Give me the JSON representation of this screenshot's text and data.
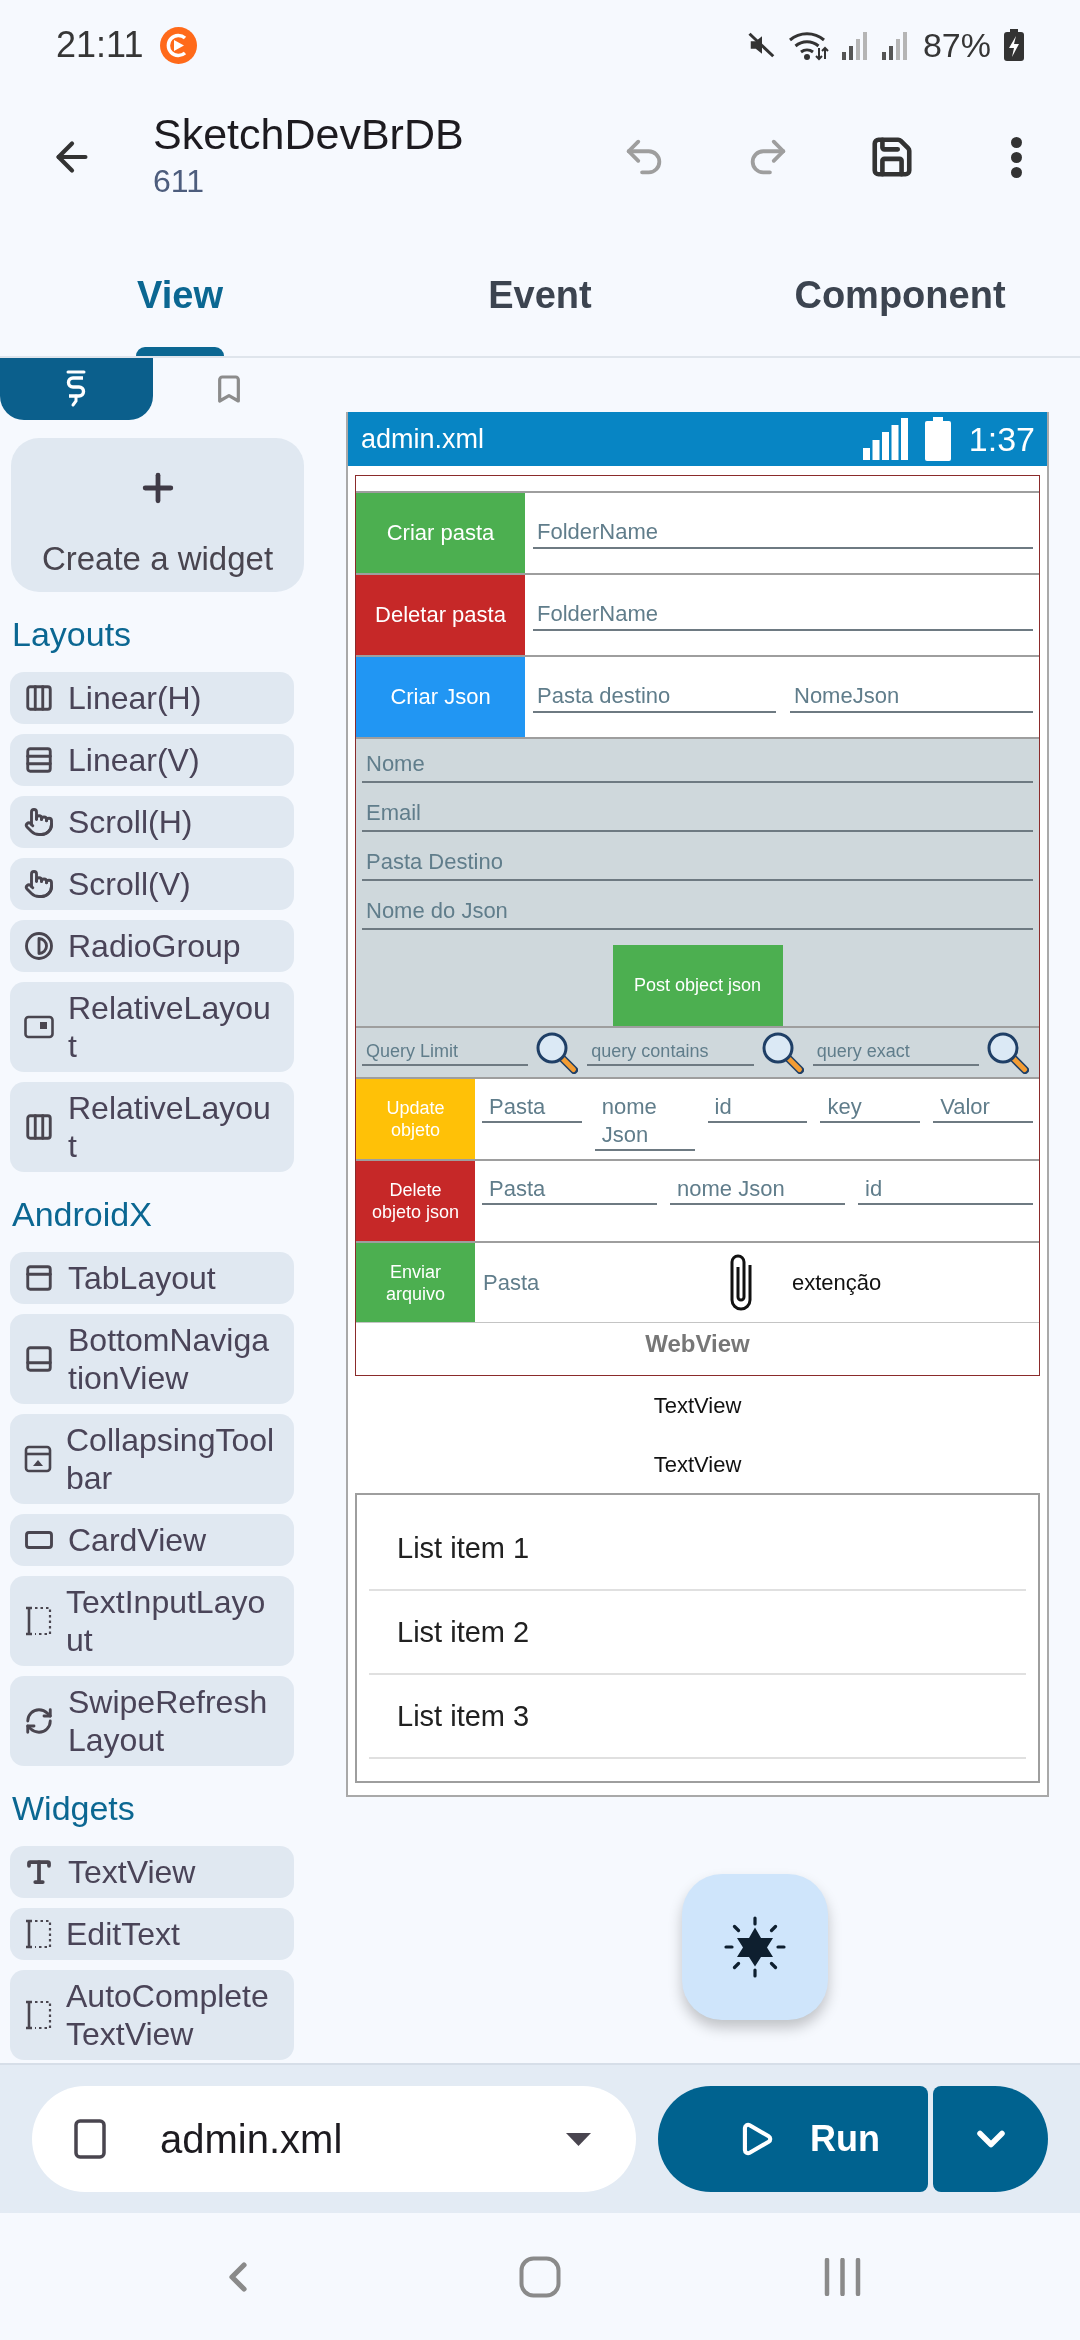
{
  "status_bar": {
    "time": "21:11",
    "battery": "87%"
  },
  "app_bar": {
    "title": "SketchDevBrDB",
    "subtitle": "611",
    "actions": [
      {
        "kind": "undo",
        "disabled": true
      },
      {
        "kind": "redo",
        "disabled": true
      },
      {
        "kind": "save",
        "disabled": false
      },
      {
        "kind": "more",
        "disabled": false
      }
    ]
  },
  "tabs": [
    {
      "label": "View",
      "selected": true
    },
    {
      "label": "Event",
      "selected": false
    },
    {
      "label": "Component",
      "selected": false
    }
  ],
  "palette": {
    "tabs": [
      {
        "kind": "widgets",
        "selected": true
      },
      {
        "kind": "bookmarks",
        "selected": false
      }
    ],
    "create_button": "Create a widget",
    "sections": [
      {
        "title": "Layouts",
        "items": [
          {
            "label": "Linear(H)",
            "kind": "columns"
          },
          {
            "label": "Linear(V)",
            "kind": "rows"
          },
          {
            "label": "Scroll(H)",
            "kind": "scroll_h"
          },
          {
            "label": "Scroll(V)",
            "kind": "scroll_v"
          },
          {
            "label": "RadioGroup",
            "kind": "radio"
          },
          {
            "label": "RelativeLayout",
            "kind": "frame"
          },
          {
            "label": "RelativeLayout",
            "kind": "columns"
          }
        ]
      },
      {
        "title": "AndroidX",
        "items": [
          {
            "label": "TabLayout",
            "kind": "tab_bar"
          },
          {
            "label": "BottomNavigationView",
            "kind": "bottom_bar"
          },
          {
            "label": "CollapsingToolbar",
            "kind": "collapsing"
          },
          {
            "label": "CardView",
            "kind": "card"
          },
          {
            "label": "TextInputLayout",
            "kind": "input"
          },
          {
            "label": "SwipeRefreshLayout",
            "kind": "refresh"
          }
        ]
      },
      {
        "title": "Widgets",
        "items": [
          {
            "label": "TextView",
            "kind": "text"
          },
          {
            "label": "EditText",
            "kind": "input"
          },
          {
            "label": "AutoCompleteTextView",
            "kind": "input"
          }
        ]
      }
    ]
  },
  "preview": {
    "title": "admin.xml",
    "clock": "1:37",
    "action_rows": [
      {
        "button": "Criar pasta",
        "color": "#4caf50",
        "fields": [
          {
            "placeholder": "FolderName"
          }
        ]
      },
      {
        "button": "Deletar pasta",
        "color": "#c62828",
        "fields": [
          {
            "placeholder": "FolderName"
          }
        ]
      },
      {
        "button": "Criar Json",
        "color": "#2196f3",
        "fields": [
          {
            "placeholder": "Pasta destino"
          },
          {
            "placeholder": "NomeJson"
          }
        ]
      }
    ],
    "form": {
      "fields": [
        {
          "placeholder": "Nome"
        },
        {
          "placeholder": "Email"
        },
        {
          "placeholder": "Pasta Destino"
        },
        {
          "placeholder": "Nome do Json"
        }
      ],
      "button": "Post object json"
    },
    "queries": [
      {
        "placeholder": "Query Limit"
      },
      {
        "placeholder": "query contains"
      },
      {
        "placeholder": "query exact"
      }
    ],
    "object_rows": [
      {
        "button": "Update objeto",
        "color": "#ffc107",
        "fields": [
          {
            "placeholder": "Pasta"
          },
          {
            "placeholder": "nome Json"
          },
          {
            "placeholder": "id"
          },
          {
            "placeholder": "key"
          },
          {
            "placeholder": "Valor"
          }
        ]
      },
      {
        "button": "Delete objeto json",
        "color": "#c62828",
        "fields": [
          {
            "placeholder": "Pasta"
          },
          {
            "placeholder": "nome Json"
          },
          {
            "placeholder": "id"
          }
        ]
      }
    ],
    "upload_row": {
      "button": "Enviar arquivo",
      "color": "#4caf50",
      "placeholder": "Pasta",
      "extension": "extenção"
    },
    "webview": "WebView",
    "text_views": [
      "TextView",
      "TextView"
    ],
    "list_items": [
      "List item 1",
      "List item 2",
      "List item 3"
    ]
  },
  "file_selector": {
    "value": "admin.xml"
  },
  "run_button": "Run"
}
